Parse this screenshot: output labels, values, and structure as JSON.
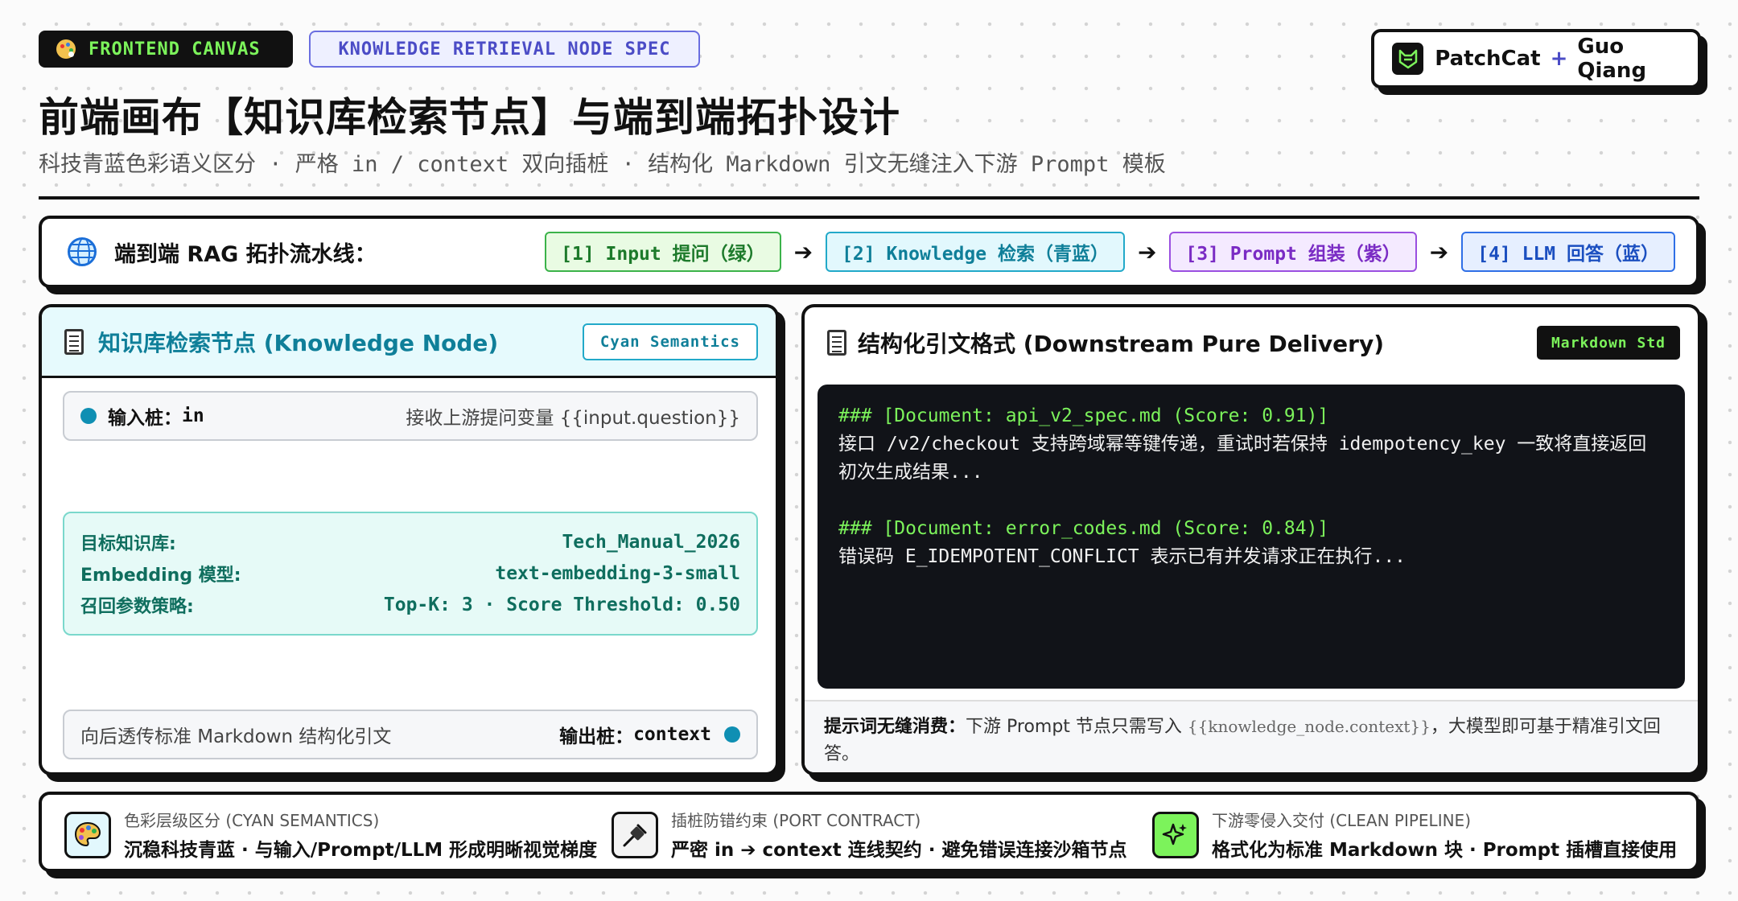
{
  "header": {
    "tag_primary": "FRONTEND CANVAS",
    "tag_secondary": "KNOWLEDGE RETRIEVAL NODE SPEC",
    "author_brand": "PatchCat",
    "author_plus": "+",
    "author_name": "Guo Qiang",
    "title": "前端画布【知识库检索节点】与端到端拓扑设计",
    "subtitle": "科技青蓝色彩语义区分 · 严格 in / context 双向插桩 · 结构化 Markdown 引文无缝注入下游 Prompt 模板"
  },
  "pipeline": {
    "label": "端到端 RAG 拓扑流水线：",
    "steps": [
      {
        "label": "[1] Input 提问（绿）",
        "color": "#3bb34a"
      },
      {
        "label": "[2] Knowledge 检索（青蓝）",
        "color": "#22a9c9"
      },
      {
        "label": "[3] Prompt 组装（紫）",
        "color": "#9a4fe0"
      },
      {
        "label": "[4] LLM 回答（蓝）",
        "color": "#2f6fe6"
      }
    ],
    "arrow": "➔"
  },
  "knowledge_node": {
    "title": "知识库检索节点 (Knowledge Node)",
    "badge": "Cyan Semantics",
    "input_port": {
      "label": "输入桩：",
      "value": "in",
      "description": "接收上游提问变量 {{input.question}}"
    },
    "config": [
      {
        "key": "目标知识库:",
        "value": "Tech_Manual_2026"
      },
      {
        "key": "Embedding 模型:",
        "value": "text-embedding-3-small"
      },
      {
        "key": "召回参数策略:",
        "value": "Top-K: 3 · Score Threshold: 0.50"
      }
    ],
    "output_port": {
      "description": "向后透传标准 Markdown 结构化引文",
      "label": "输出桩：",
      "value": "context"
    }
  },
  "citation_panel": {
    "title": "结构化引文格式 (Downstream Pure Delivery)",
    "badge": "Markdown Std",
    "code": [
      {
        "heading": "### [Document: api_v2_spec.md (Score: 0.91)]",
        "body": "接口 /v2/checkout 支持跨域幂等键传递，重试时若保持 idempotency_key 一致将直接返回初次生成结果..."
      },
      {
        "heading": "### [Document: error_codes.md (Score: 0.84)]",
        "body": "错误码 E_IDEMPOTENT_CONFLICT 表示已有并发请求正在执行..."
      }
    ],
    "tip_label": "提示词无缝消费：",
    "tip_pre": "下游 Prompt 节点只需写入 ",
    "tip_code": "{{knowledge_node.context}}",
    "tip_post": "，大模型即可基于精准引文回答。"
  },
  "footer": {
    "features": [
      {
        "icon": "palette-icon",
        "title": "色彩层级区分 (CYAN SEMANTICS)",
        "desc": "沉稳科技青蓝 · 与输入/Prompt/LLM 形成明晰视觉梯度"
      },
      {
        "icon": "plug-icon",
        "title": "插桩防错约束 (PORT CONTRACT)",
        "desc": "严密 in ➔ context 连线契约 · 避免错误连接沙箱节点"
      },
      {
        "icon": "sparkle-icon",
        "title": "下游零侵入交付 (CLEAN PIPELINE)",
        "desc": "格式化为标准 Markdown 块 · Prompt 插槽直接使用"
      }
    ]
  }
}
